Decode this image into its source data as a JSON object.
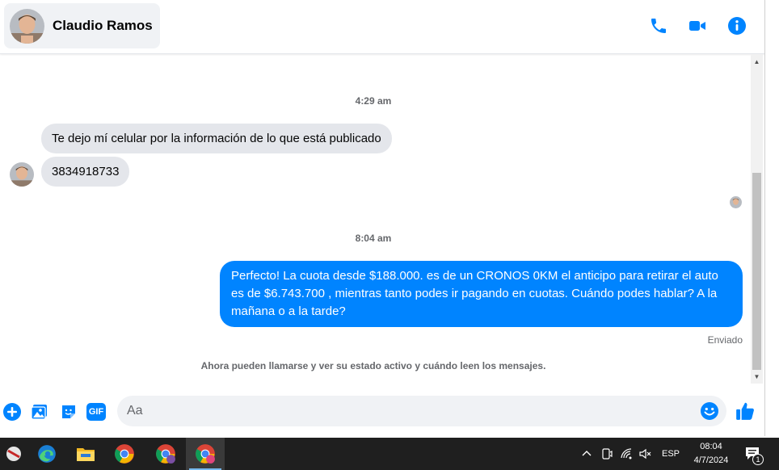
{
  "header": {
    "contact_name": "Claudio Ramos",
    "accent_color": "#0084ff"
  },
  "messages": {
    "timestamp_1": "4:29 am",
    "incoming_1": "Te dejo mí celular por la información de lo que está publicado",
    "incoming_2": "3834918733",
    "timestamp_2": "8:04 am",
    "outgoing_1": "Perfecto! La cuota desde $188.000. es de un CRONOS 0KM el anticipo para retirar el auto es de $6.743.700 , mientras tanto podes ir pagando en cuotas. Cuándo podes hablar? A la mañana o a la tarde?",
    "status_sent": "Enviado",
    "info_line": "Ahora pueden llamarse y ver su estado activo y cuándo leen los mensajes."
  },
  "composer": {
    "placeholder": "Aa",
    "gif_label": "GIF"
  },
  "taskbar": {
    "language": "ESP",
    "time": "08:04",
    "date": "4/7/2024",
    "notification_count": "1"
  }
}
